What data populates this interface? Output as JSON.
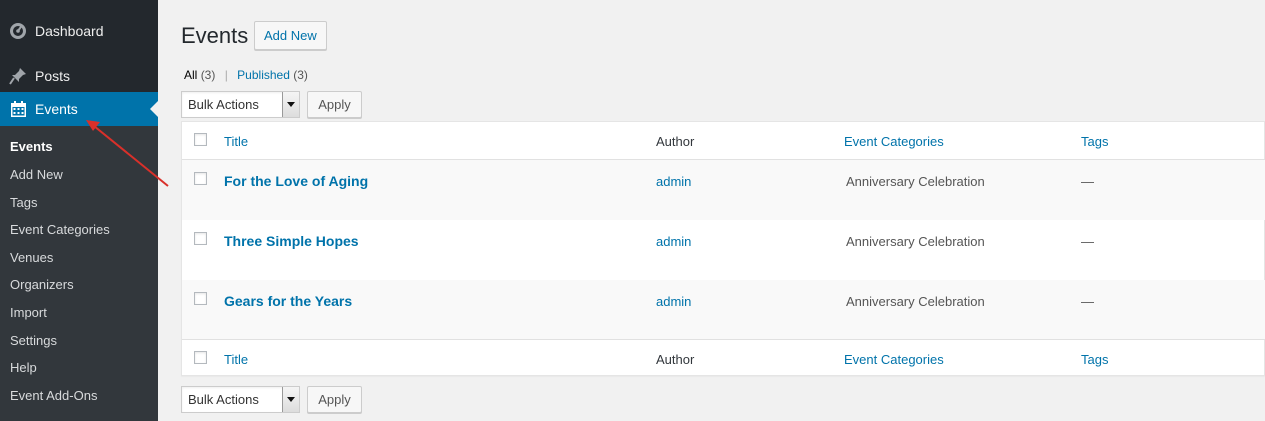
{
  "sidebar": {
    "top_items": [
      {
        "label": "Dashboard",
        "icon": "dashboard-icon"
      },
      {
        "label": "Posts",
        "icon": "pin-icon"
      },
      {
        "label": "Events",
        "icon": "calendar-icon"
      }
    ],
    "submenu": [
      "Events",
      "Add New",
      "Tags",
      "Event Categories",
      "Venues",
      "Organizers",
      "Import",
      "Settings",
      "Help",
      "Event Add-Ons"
    ]
  },
  "header": {
    "title": "Events",
    "add_new": "Add New"
  },
  "filters": {
    "all_label": "All",
    "all_count": "(3)",
    "separator": "|",
    "published_label": "Published",
    "published_count": "(3)"
  },
  "bulk": {
    "select_label": "Bulk Actions",
    "apply_label": "Apply"
  },
  "table": {
    "columns": [
      "Title",
      "Author",
      "Event Categories",
      "Tags"
    ],
    "rows": [
      {
        "title": "For the Love of Aging",
        "author": "admin",
        "category": "Anniversary Celebration",
        "tags": "—"
      },
      {
        "title": "Three Simple Hopes",
        "author": "admin",
        "category": "Anniversary Celebration",
        "tags": "—"
      },
      {
        "title": "Gears for the Years",
        "author": "admin",
        "category": "Anniversary Celebration",
        "tags": "—"
      }
    ]
  },
  "colors": {
    "sidebar_bg": "#23282d",
    "submenu_bg": "#32373c",
    "accent": "#0073aa",
    "annotation_arrow": "#d9302a"
  }
}
